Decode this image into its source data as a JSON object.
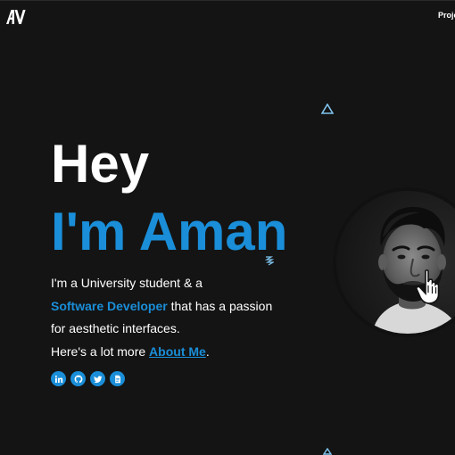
{
  "brand": {
    "logo_text": "AV"
  },
  "nav": {
    "projects_label": "Proje"
  },
  "hero": {
    "greeting": "Hey",
    "name": "I'm Aman"
  },
  "bio": {
    "line1": "I'm a University student & a",
    "highlight": "Software Developer",
    "line2_rest": " that has a passion",
    "line3": "for aesthetic interfaces.",
    "line4_prefix": "Here's a lot more ",
    "about_link": "About Me",
    "line4_suffix": "."
  },
  "socials": [
    {
      "icon": "linkedin-icon",
      "label": "in"
    },
    {
      "icon": "github-icon"
    },
    {
      "icon": "twitter-icon"
    },
    {
      "icon": "resume-icon"
    }
  ],
  "colors": {
    "background": "#141414",
    "accent": "#1a8ed8",
    "text": "#ffffff"
  }
}
